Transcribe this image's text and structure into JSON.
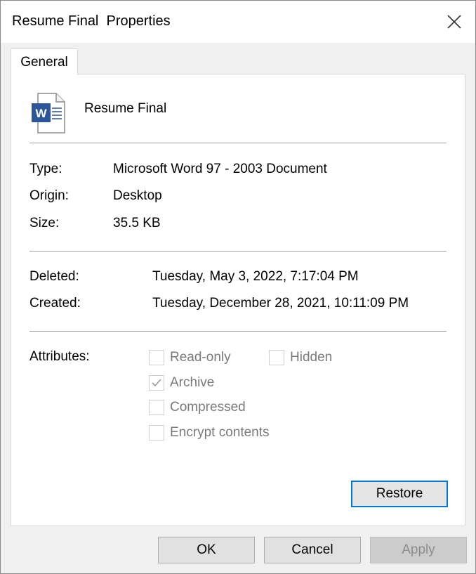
{
  "window": {
    "title": "Resume Final  Properties",
    "close_icon": "close-icon"
  },
  "tabs": [
    {
      "label": "General",
      "selected": true
    }
  ],
  "file": {
    "icon": "word-document-icon",
    "name": "Resume Final"
  },
  "details": {
    "type_label": "Type:",
    "type_value": "Microsoft Word 97 - 2003 Document",
    "origin_label": "Origin:",
    "origin_value": "Desktop",
    "size_label": "Size:",
    "size_value": "35.5 KB"
  },
  "dates": {
    "deleted_label": "Deleted:",
    "deleted_value": "Tuesday, May 3, 2022, 7:17:04 PM",
    "created_label": "Created:",
    "created_value": "Tuesday, December 28, 2021, 10:11:09 PM"
  },
  "attributes": {
    "label": "Attributes:",
    "read_only": {
      "label": "Read-only",
      "checked": false
    },
    "hidden": {
      "label": "Hidden",
      "checked": false
    },
    "archive": {
      "label": "Archive",
      "checked": true
    },
    "compressed": {
      "label": "Compressed",
      "checked": false
    },
    "encrypt": {
      "label": "Encrypt contents",
      "checked": false
    }
  },
  "buttons": {
    "restore": "Restore",
    "ok": "OK",
    "cancel": "Cancel",
    "apply": "Apply"
  },
  "colors": {
    "accent": "#0078d7",
    "word_blue": "#2b579a",
    "disabled_text": "#7a7a7a"
  }
}
